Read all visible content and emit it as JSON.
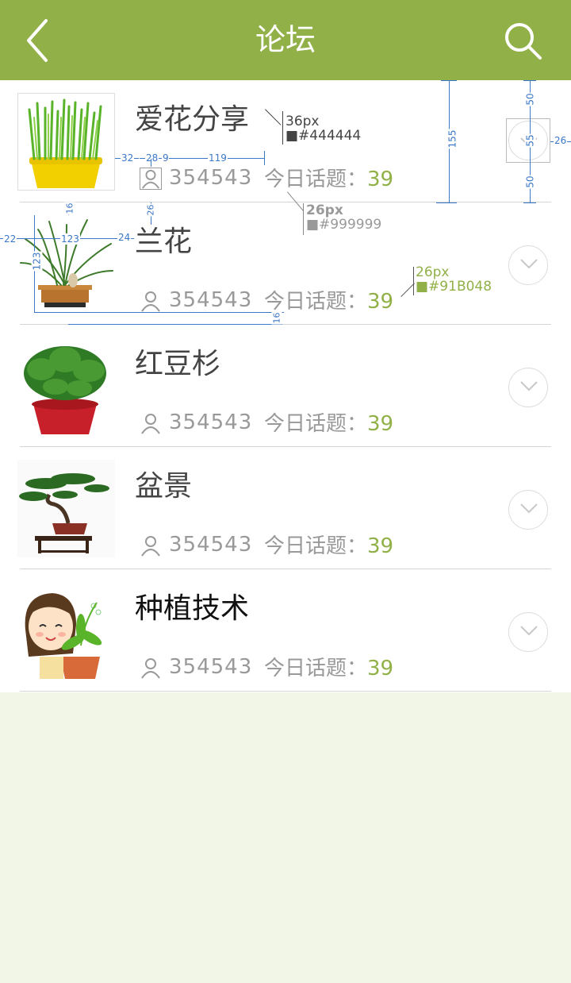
{
  "header": {
    "title": "论坛",
    "back_icon": "chevron-left-icon",
    "search_icon": "search-icon",
    "background": "#91b048"
  },
  "forums": [
    {
      "title": "爱花分享",
      "members": "354543",
      "today_label": "今日话题：",
      "today_count": "39",
      "thumb": "wheatgrass-pot"
    },
    {
      "title": "兰花",
      "members": "354543",
      "today_label": "今日话题：",
      "today_count": "39",
      "thumb": "orchid-pot"
    },
    {
      "title": "红豆杉",
      "members": "354543",
      "today_label": "今日话题：",
      "today_count": "39",
      "thumb": "yew-pot"
    },
    {
      "title": "盆景",
      "members": "354543",
      "today_label": "今日话题：",
      "today_count": "39",
      "thumb": "bonsai-pine"
    },
    {
      "title": "种植技术",
      "members": "354543",
      "today_label": "今日话题：",
      "today_count": "39",
      "thumb": "girl-with-plant"
    }
  ],
  "spec_notes": {
    "title_size": "36px",
    "title_color": "■#444444",
    "meta_size": "26px",
    "meta_color": "■#999999",
    "accent_size": "26px",
    "accent_color": "■#91B048"
  },
  "dimensions": {
    "d32": "32",
    "d28": "28",
    "d9": "9",
    "d119": "119",
    "d16a": "16",
    "d26": "26",
    "d22": "22",
    "d123w": "123",
    "d24": "24",
    "d123h": "123",
    "d16b": "16",
    "d155": "155",
    "d50a": "50",
    "d55": "55",
    "d50b": "50",
    "d26r": "26"
  },
  "colors": {
    "title": "#444444",
    "meta": "#999999",
    "accent": "#91B048",
    "divider": "#d4d4d4",
    "page_bg": "#f2f6e6"
  }
}
